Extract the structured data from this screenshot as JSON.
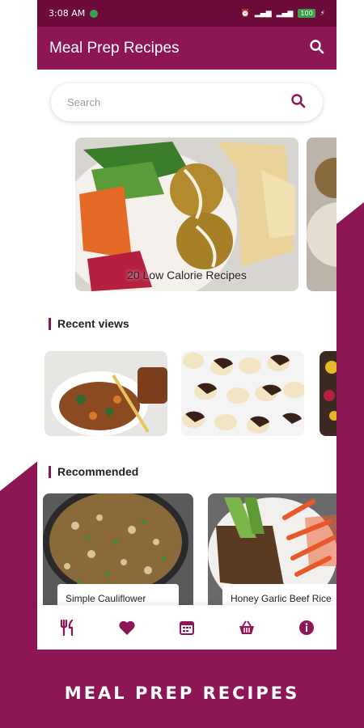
{
  "status_bar": {
    "time": "3:08 AM",
    "battery": "100"
  },
  "app_bar": {
    "title": "Meal Prep Recipes"
  },
  "search": {
    "placeholder": "Search"
  },
  "featured": {
    "caption": "20 Low Calorie Recipes"
  },
  "recent": {
    "heading": "Recent views"
  },
  "recommended": {
    "heading": "Recommended",
    "items": [
      {
        "label": "Simple Cauliflower Fried Rice"
      },
      {
        "label": "Honey Garlic Beef Rice Bowls"
      }
    ]
  },
  "bottom_nav": [
    "utensils-icon",
    "heart-icon",
    "calendar-icon",
    "basket-icon",
    "info-icon"
  ],
  "footer": {
    "title": "MEAL PREP RECIPES"
  },
  "colors": {
    "primary": "#8e1657",
    "primary_dark": "#6c0a3a",
    "background": "#ffffff"
  }
}
